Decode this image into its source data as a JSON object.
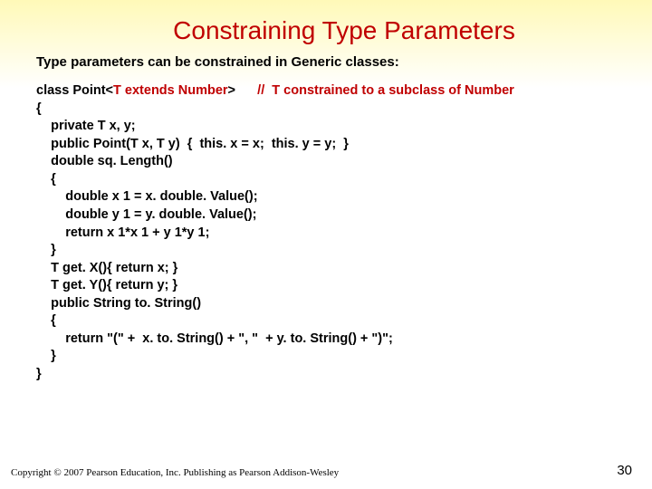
{
  "title": "Constraining Type Parameters",
  "subtitle": "Type parameters can be constrained in Generic classes:",
  "code": {
    "l1a": "class Point<",
    "l1b": "T extends Number",
    "l1c": ">      ",
    "l1d": "//  T constrained to a subclass of Number",
    "l2": "{",
    "l3": "    private T x, y;",
    "l4": "    public Point(T x, T y)  {  this. x = x;  this. y = y;  }",
    "l5": "    double sq. Length()",
    "l6": "    {",
    "l7": "        double x 1 = x. double. Value();",
    "l8": "        double y 1 = y. double. Value();",
    "l9": "        return x 1*x 1 + y 1*y 1;",
    "l10": "    }",
    "l11": "    T get. X(){ return x; }",
    "l12": "    T get. Y(){ return y; }",
    "l13": "    public String to. String()",
    "l14": "    {",
    "l15": "        return \"(\" +  x. to. String() + \", \"  + y. to. String() + \")\";",
    "l16": "    }",
    "l17": "}"
  },
  "footer": "Copyright © 2007 Pearson Education, Inc. Publishing as Pearson Addison-Wesley",
  "page_number": "30"
}
